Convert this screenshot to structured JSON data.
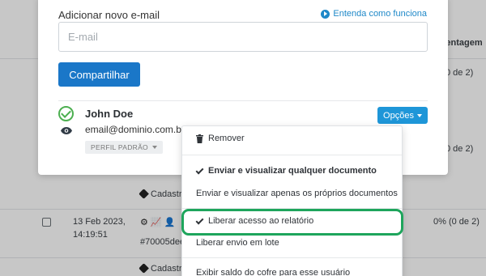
{
  "background": {
    "column_header_partial": "rcentagem",
    "row1_percent_partial": "0 de 2)",
    "row2_date": "13 Feb 2023,",
    "row2_time": "14:19:51",
    "row2_doc_id_partial": "#70005dee",
    "row2_percent": "0% (0 de 2)",
    "tag_label_partial": "Cadastr"
  },
  "modal": {
    "add_email_label": "Adicionar novo e-mail",
    "help_link": "Entenda como funciona",
    "email_input": {
      "value": "",
      "placeholder": "E-mail"
    },
    "share_button": "Compartilhar",
    "user": {
      "name": "John Doe",
      "email": "email@dominio.com.br",
      "profile_badge": "PERFIL PADRÃO",
      "options_button": "Opções"
    }
  },
  "dropdown": {
    "items": [
      {
        "label": "Remover",
        "icon": "trash-icon",
        "checked": false
      },
      {
        "label": "Enviar e visualizar qualquer documento",
        "checked": true
      },
      {
        "label": "Enviar e visualizar apenas os próprios documentos",
        "checked": false
      },
      {
        "label": "Liberar acesso ao relatório",
        "checked": true,
        "highlighted": true
      },
      {
        "label": "Liberar envio em lote",
        "checked": false
      },
      {
        "label": "Exibir saldo do cofre para esse usuário",
        "checked": false
      }
    ]
  },
  "colors": {
    "primary_button": "#1a77c8",
    "options_button": "#1e96d8",
    "success_check": "#4caf50",
    "highlight_outline": "#1ea55c",
    "link": "#1e88c8"
  }
}
